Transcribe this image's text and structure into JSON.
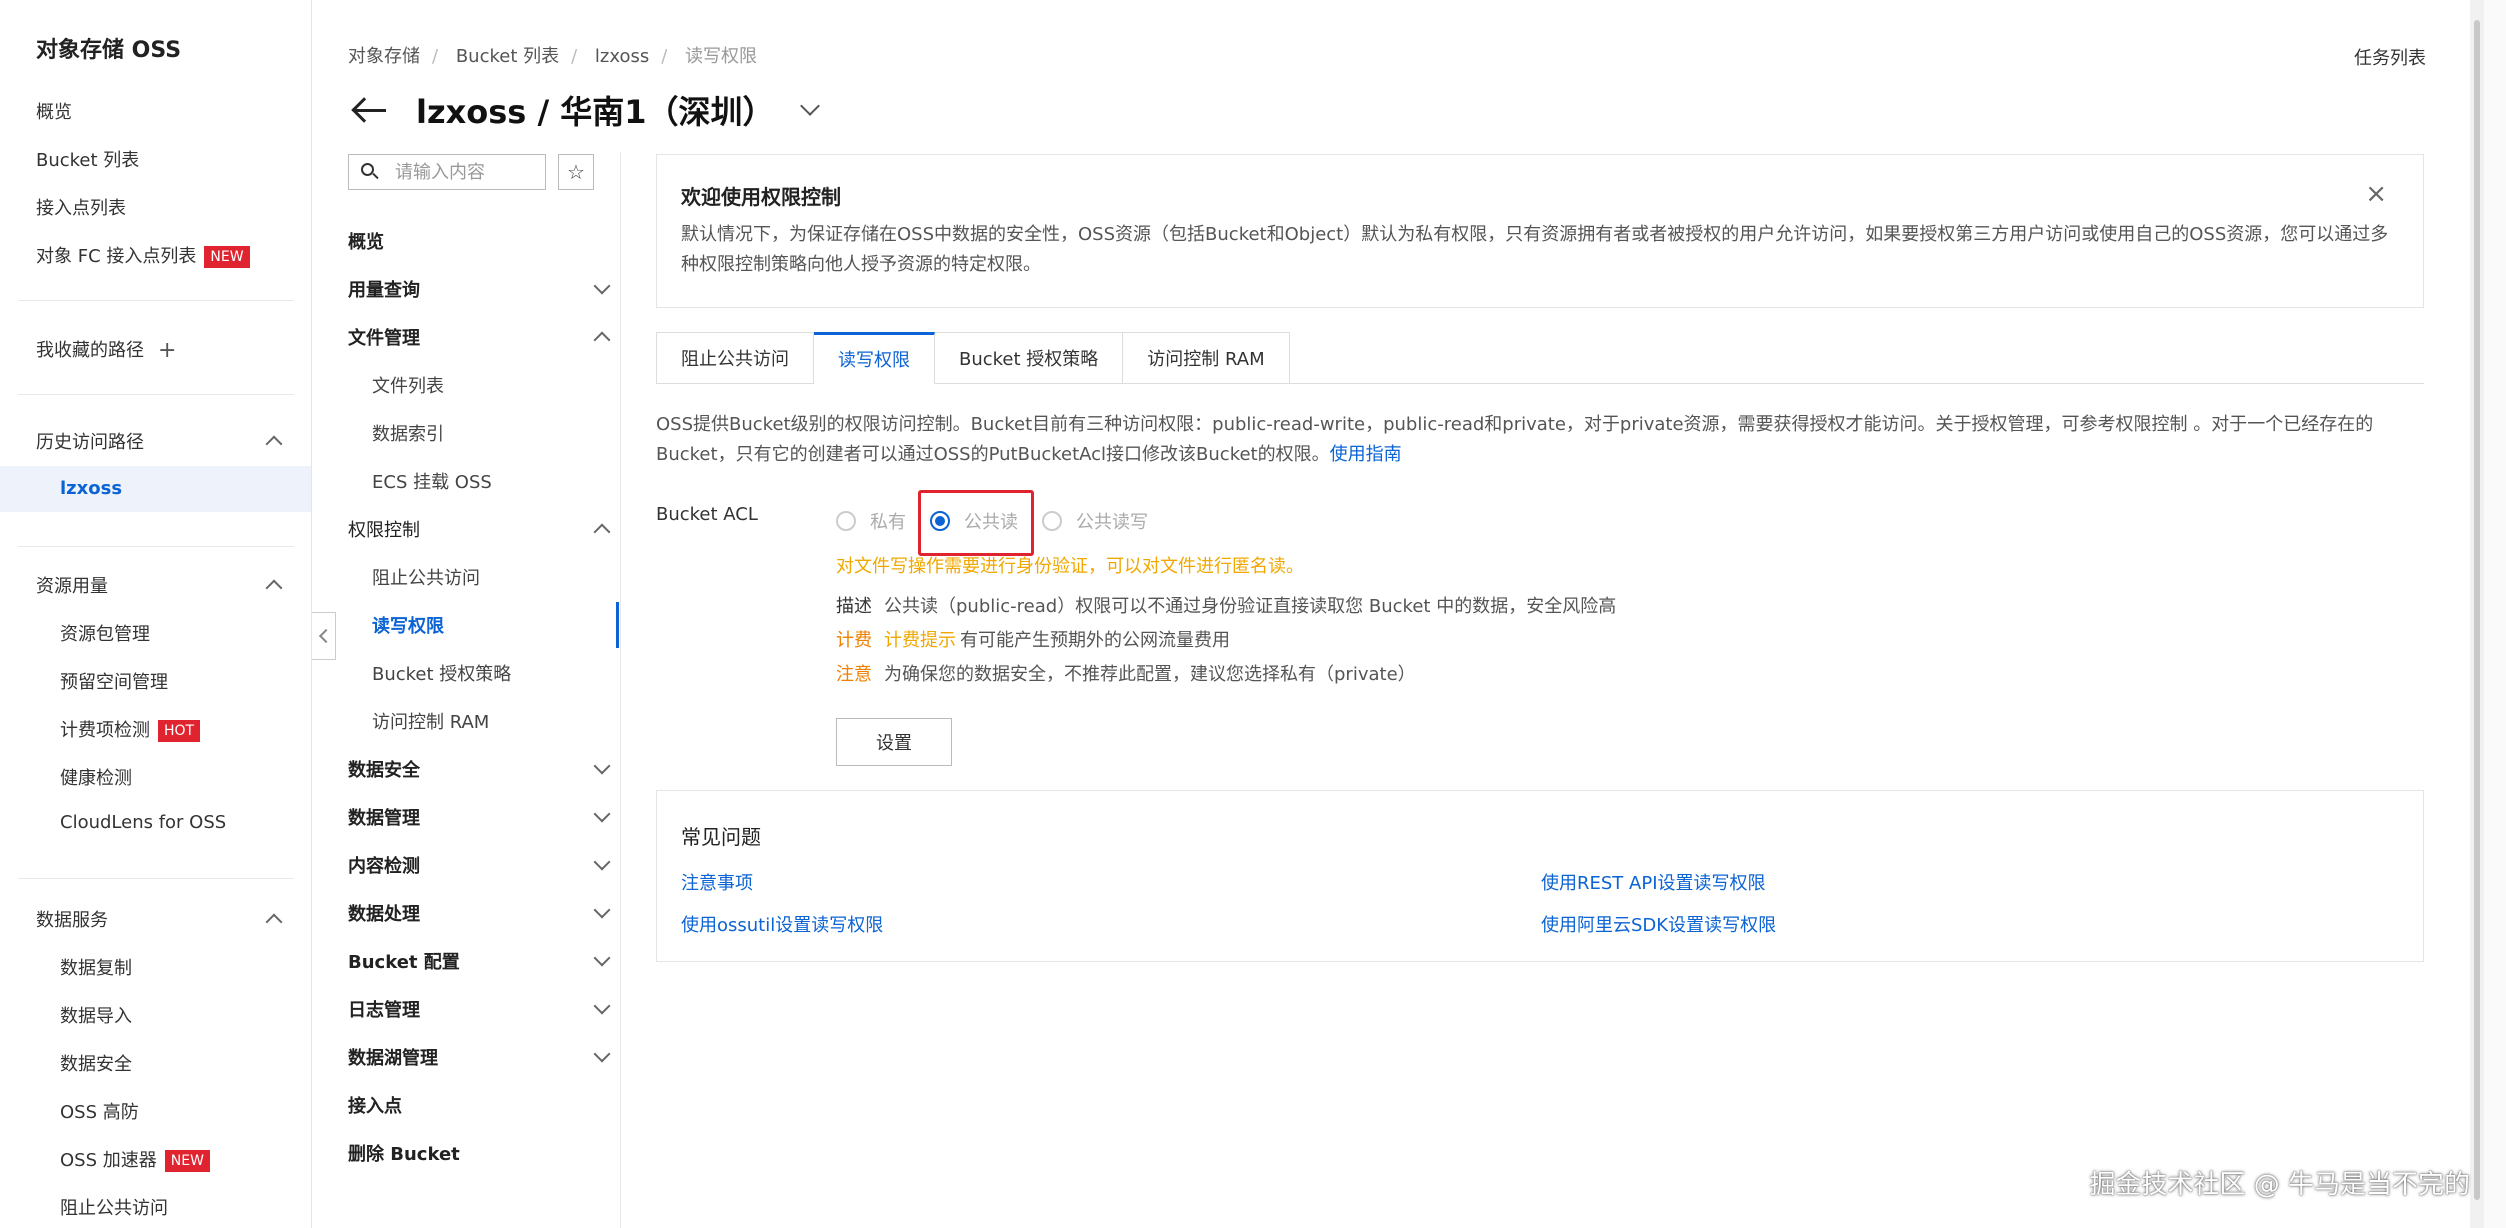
{
  "leftnav": {
    "title": "对象存储 OSS",
    "items": [
      "概览",
      "Bucket 列表",
      "接入点列表"
    ],
    "fc_item": "对象 FC 接入点列表",
    "fc_tag": "NEW",
    "favorites": "我收藏的路径",
    "favorites_icon": "+",
    "history": {
      "title": "历史访问路径",
      "items": [
        "lzxoss"
      ]
    },
    "resources": {
      "title": "资源用量",
      "items": [
        "资源包管理",
        "预留空间管理"
      ],
      "billing": "计费项检测",
      "billing_tag": "HOT",
      "items2": [
        "健康检测",
        "CloudLens for OSS"
      ]
    },
    "data_services": {
      "title": "数据服务",
      "items": [
        "数据复制",
        "数据导入",
        "数据安全",
        "OSS 高防"
      ],
      "accel": "OSS 加速器",
      "accel_tag": "NEW",
      "cut": "阻止公共访问"
    }
  },
  "header": {
    "breadcrumb": [
      "对象存储",
      "Bucket 列表",
      "lzxoss",
      "读写权限"
    ],
    "title": "lzxoss / 华南1（深圳）",
    "task_list": "任务列表"
  },
  "subnav": {
    "search_placeholder": "请输入内容",
    "star_icon": "☆",
    "overview": "概览",
    "usage": "用量查询",
    "file_mgmt": "文件管理",
    "file_items": [
      "文件列表",
      "数据索引",
      "ECS 挂载 OSS"
    ],
    "perm": "权限控制",
    "perm_items": [
      "阻止公共访问",
      "读写权限",
      "Bucket 授权策略",
      "访问控制 RAM"
    ],
    "groups": [
      "数据安全",
      "数据管理",
      "内容检测",
      "数据处理",
      "Bucket 配置",
      "日志管理",
      "数据湖管理"
    ],
    "access_point": "接入点",
    "delete_bucket": "删除 Bucket"
  },
  "welcome": {
    "title": "欢迎使用权限控制",
    "text": "默认情况下，为保证存储在OSS中数据的安全性，OSS资源（包括Bucket和Object）默认为私有权限，只有资源拥有者或者被授权的用户允许访问，如果要授权第三方用户访问或使用自己的OSS资源，您可以通过多种权限控制策略向他人授予资源的特定权限。",
    "close": "×"
  },
  "tabs": [
    "阻止公共访问",
    "读写权限",
    "Bucket 授权策略",
    "访问控制 RAM"
  ],
  "desc": {
    "text": "OSS提供Bucket级别的权限访问控制。Bucket目前有三种访问权限：public-read-write，public-read和private，对于private资源，需要获得授权才能访问。关于授权管理，可参考权限控制 。对于一个已经存在的Bucket，只有它的创建者可以通过OSS的PutBucketAcl接口修改该Bucket的权限。",
    "link": "使用指南"
  },
  "acl": {
    "label": "Bucket ACL",
    "options": [
      "私有",
      "公共读",
      "公共读写"
    ],
    "selected": "公共读",
    "warning": "对文件写操作需要进行身份验证，可以对文件进行匿名读。",
    "desc_key": "描述",
    "desc_val": "公共读（public-read）权限可以不通过身份验证直接读取您 Bucket 中的数据，安全风险高",
    "billing_key": "计费",
    "billing_tip": "计费提示",
    "billing_val": "有可能产生预期外的公网流量费用",
    "note_key": "注意",
    "note_val": "为确保您的数据安全，不推荐此配置，建议您选择私有（private）",
    "button": "设置"
  },
  "faq": {
    "title": "常见问题",
    "links": [
      "注意事项",
      "使用REST API设置读写权限",
      "使用ossutil设置读写权限",
      "使用阿里云SDK设置读写权限"
    ]
  },
  "watermark": "掘金技术社区 @ 牛马是当不完的",
  "colors": {
    "accent": "#0b63d4",
    "tag": "#e0242f",
    "warning": "#f0a800",
    "highlight": "#e0242f"
  }
}
